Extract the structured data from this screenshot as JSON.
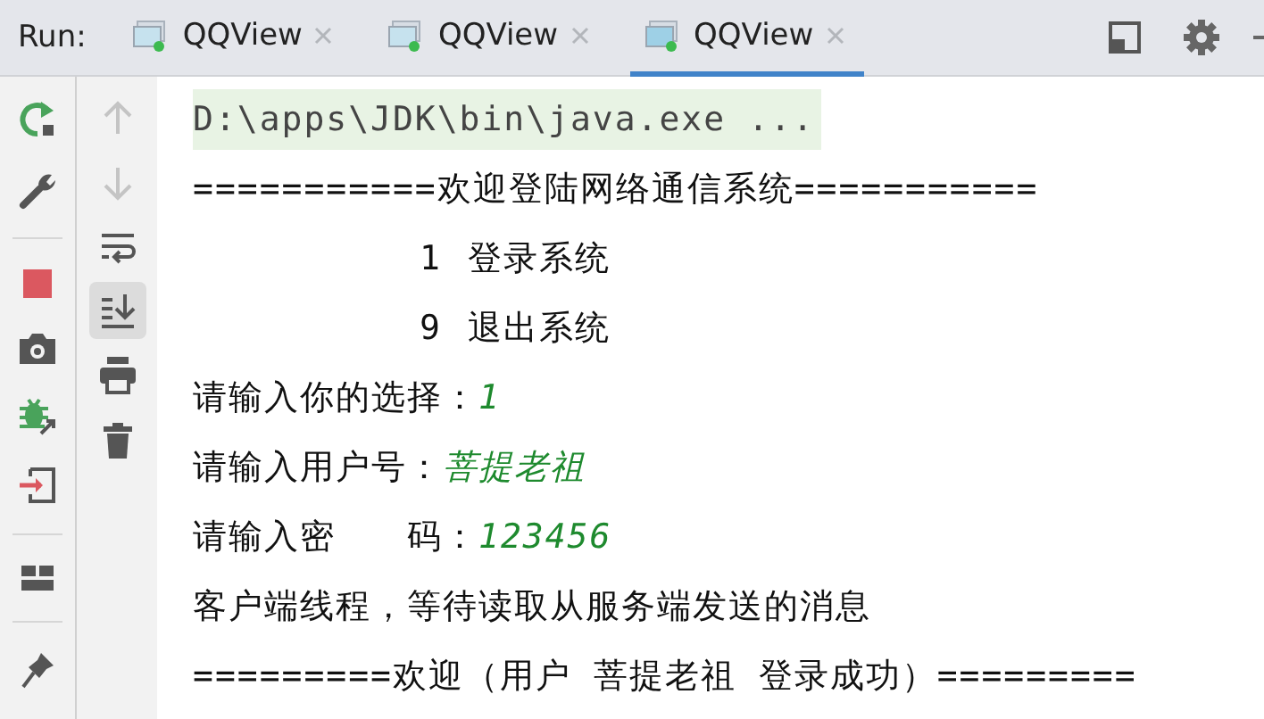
{
  "run_label": "Run:",
  "tabs": [
    {
      "label": "QQView",
      "selected": false
    },
    {
      "label": "QQView",
      "selected": false
    },
    {
      "label": "QQView",
      "selected": true
    }
  ],
  "toolbar": {
    "navigation_disabled": true,
    "scroll_to_end_on": true
  },
  "console": [
    {
      "kind": "command",
      "text": "D:\\apps\\JDK\\bin\\java.exe ..."
    },
    {
      "kind": "output",
      "text": "===========欢迎登陆网络通信系统==========="
    },
    {
      "kind": "menu",
      "number": "1",
      "text": "登录系统"
    },
    {
      "kind": "menu",
      "number": "9",
      "text": "退出系统"
    },
    {
      "kind": "prompt",
      "text": "请输入你的选择：",
      "input": "1"
    },
    {
      "kind": "prompt",
      "text": "请输入用户号：",
      "input": "菩提老祖"
    },
    {
      "kind": "prompt",
      "text": "请输入密　　码：",
      "input": "123456"
    },
    {
      "kind": "output",
      "text": "客户端线程，等待读取从服务端发送的消息"
    },
    {
      "kind": "output",
      "text": "=========欢迎（用户 菩提老祖 登录成功）========="
    }
  ]
}
